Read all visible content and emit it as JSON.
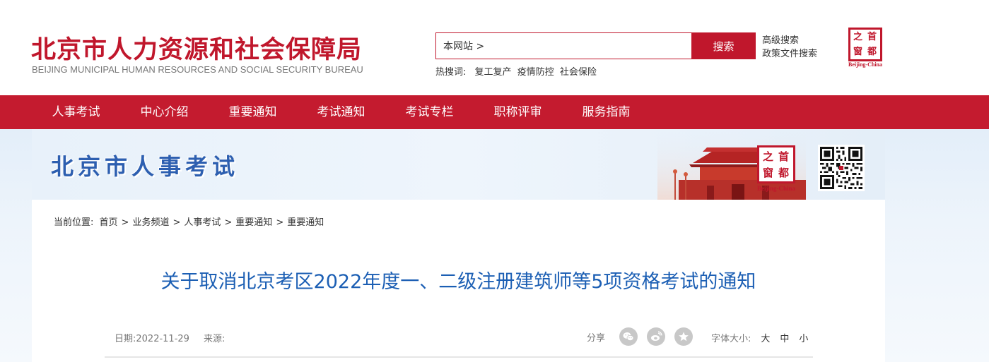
{
  "header": {
    "title_cn": "北京市人力资源和社会保障局",
    "title_en": "BEIJING MUNICIPAL HUMAN RESOURCES AND SOCIAL SECURITY BUREAU",
    "search": {
      "value": "本网站 >",
      "button_label": "搜索"
    },
    "advanced_search_label": "高级搜索",
    "policy_search_label": "政策文件搜索",
    "hot_label": "热搜词:",
    "hot_words": [
      "复工复产",
      "疫情防控",
      "社会保险"
    ],
    "seal": {
      "chars": [
        "之",
        "首",
        "窗",
        "都"
      ],
      "caption": "Beijing-China"
    }
  },
  "nav": {
    "items": [
      "人事考试",
      "中心介绍",
      "重要通知",
      "考试通知",
      "考试专栏",
      "职称评审",
      "服务指南"
    ]
  },
  "banner": {
    "title": "北京市人事考试",
    "seal": {
      "chars": [
        "之",
        "首",
        "窗",
        "都"
      ],
      "caption": "Beijing-China"
    },
    "qr_icon": "qr-code-icon"
  },
  "breadcrumb": {
    "label": "当前位置:",
    "items": [
      "首页",
      "业务频道",
      "人事考试",
      "重要通知",
      "重要通知"
    ]
  },
  "article": {
    "title": "关于取消北京考区2022年度一、二级注册建筑师等5项资格考试的通知",
    "date_label": "日期:",
    "date": "2022-11-29",
    "source_label": "来源:",
    "share_label": "分享",
    "share_icons": [
      "wechat-icon",
      "weibo-icon",
      "star-icon"
    ],
    "font_size_label": "字体大小:",
    "font_sizes": [
      "大",
      "中",
      "小"
    ]
  },
  "colors": {
    "brand_red": "#c0172c",
    "nav_red": "#c41b2f",
    "title_blue": "#1c5fb4",
    "banner_blue": "#2d5fb0"
  }
}
